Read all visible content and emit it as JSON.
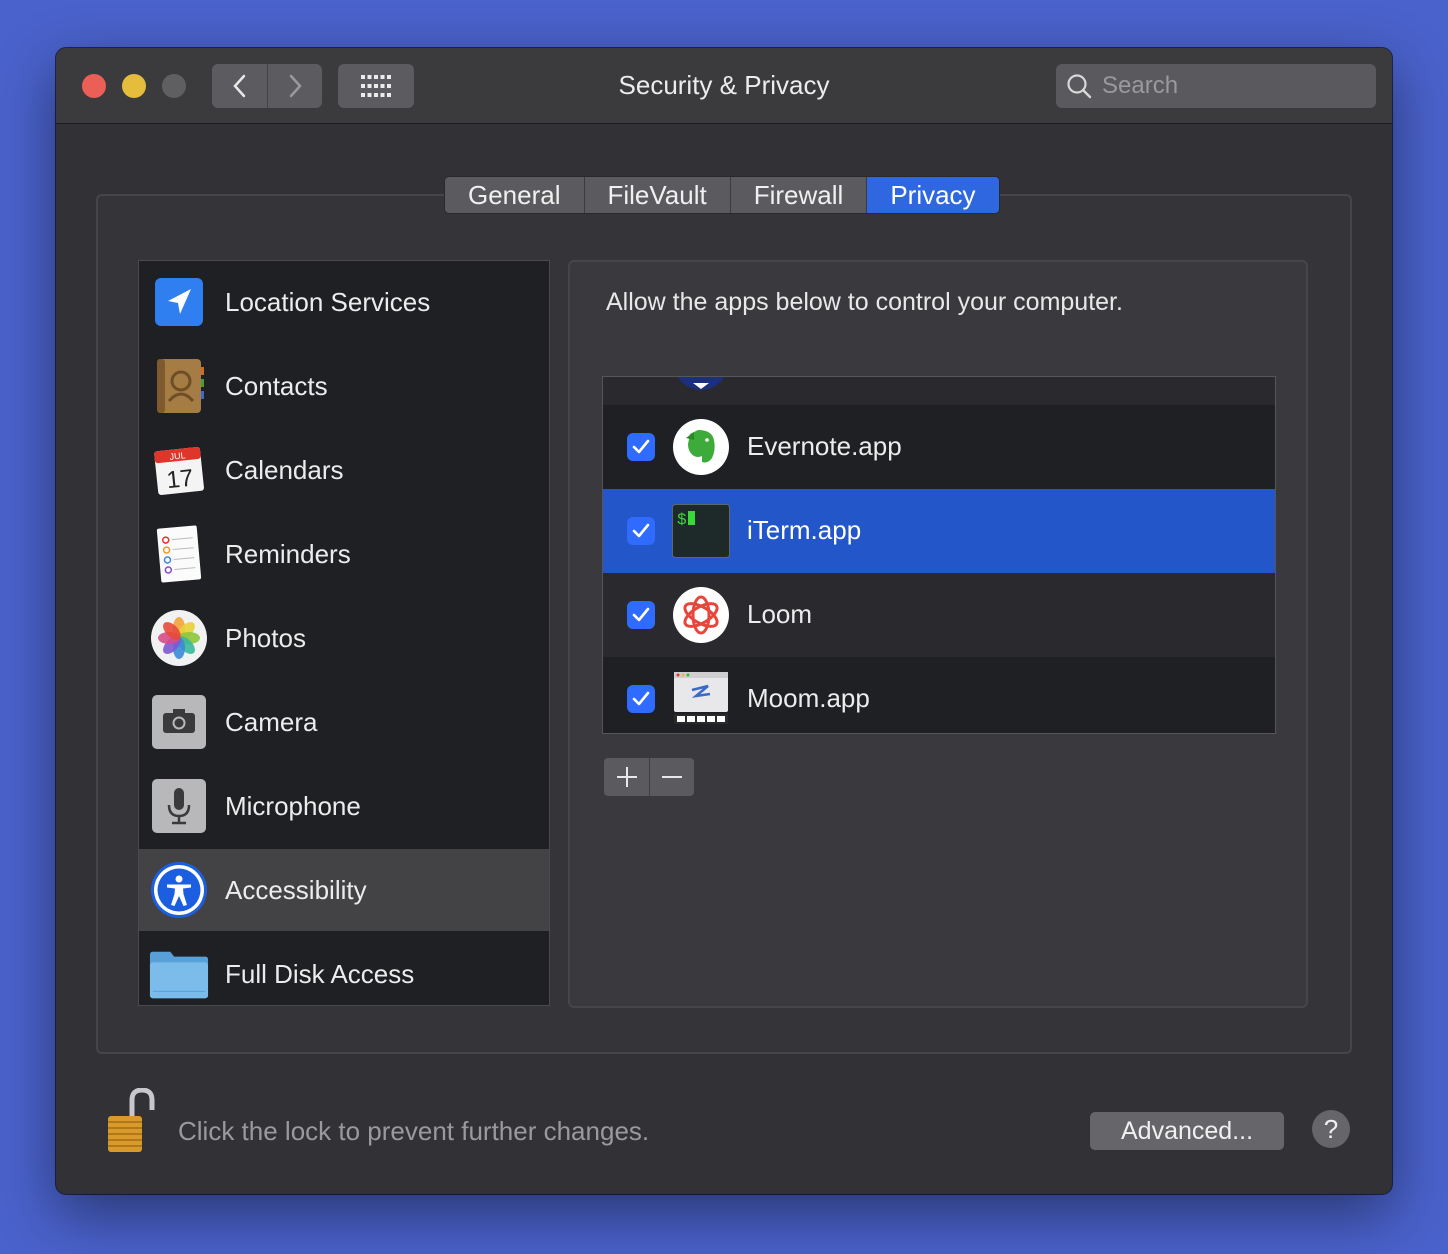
{
  "window": {
    "title": "Security & Privacy"
  },
  "search": {
    "placeholder": "Search"
  },
  "tabs": [
    {
      "label": "General"
    },
    {
      "label": "FileVault"
    },
    {
      "label": "Firewall"
    },
    {
      "label": "Privacy",
      "active": true
    }
  ],
  "sidebar": {
    "items": [
      {
        "label": "Location Services",
        "icon": "location-arrow-icon"
      },
      {
        "label": "Contacts",
        "icon": "contacts-book-icon"
      },
      {
        "label": "Calendars",
        "icon": "calendar-icon",
        "icon_month": "JUL",
        "icon_day": "17"
      },
      {
        "label": "Reminders",
        "icon": "reminders-icon"
      },
      {
        "label": "Photos",
        "icon": "photos-flower-icon"
      },
      {
        "label": "Camera",
        "icon": "camera-icon"
      },
      {
        "label": "Microphone",
        "icon": "microphone-icon"
      },
      {
        "label": "Accessibility",
        "icon": "accessibility-icon",
        "selected": true
      },
      {
        "label": "Full Disk Access",
        "icon": "folder-icon"
      }
    ]
  },
  "panel": {
    "description": "Allow the apps below to control your computer.",
    "apps": [
      {
        "name": "Evernote.app",
        "checked": true,
        "icon": "evernote-elephant-icon"
      },
      {
        "name": "iTerm.app",
        "checked": true,
        "icon": "terminal-icon",
        "selected": true
      },
      {
        "name": "Loom",
        "checked": true,
        "icon": "loom-icon"
      },
      {
        "name": "Moom.app",
        "checked": true,
        "icon": "moom-icon"
      }
    ],
    "add_symbol": "+",
    "remove_symbol": "—"
  },
  "footer": {
    "lock_text": "Click the lock to prevent further changes.",
    "advanced_label": "Advanced...",
    "help_label": "?"
  },
  "colors": {
    "accent": "#2f67e0",
    "selection": "#2357c9",
    "background": "#4a62cc"
  }
}
